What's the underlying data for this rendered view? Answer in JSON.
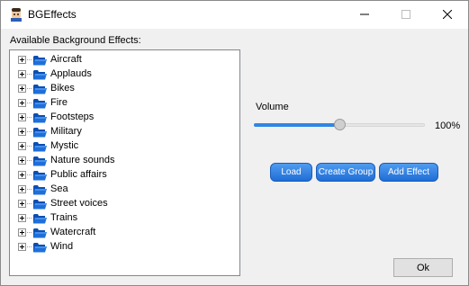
{
  "window": {
    "title": "BGEffects",
    "icon": "bgeffects-app-icon",
    "controls": [
      "minimize-icon",
      "maximize-icon",
      "close-icon"
    ]
  },
  "effects_panel": {
    "label": "Available Background Effects:",
    "items": [
      {
        "label": "Aircraft"
      },
      {
        "label": "Applauds"
      },
      {
        "label": "Bikes"
      },
      {
        "label": "Fire"
      },
      {
        "label": "Footsteps"
      },
      {
        "label": "Military"
      },
      {
        "label": "Mystic"
      },
      {
        "label": "Nature sounds"
      },
      {
        "label": "Public affairs"
      },
      {
        "label": "Sea"
      },
      {
        "label": "Street voices"
      },
      {
        "label": "Trains"
      },
      {
        "label": "Watercraft"
      },
      {
        "label": "Wind"
      }
    ]
  },
  "volume": {
    "label": "Volume",
    "value_text": "100%",
    "level": 0.5
  },
  "buttons": {
    "load": "Load",
    "create_group": "Create Group",
    "add_effect": "Add Effect",
    "ok": "Ok"
  },
  "colors": {
    "accent": "#2f86e3",
    "button_blue": "#1f6dd6",
    "folder": "#1e6fd9"
  }
}
